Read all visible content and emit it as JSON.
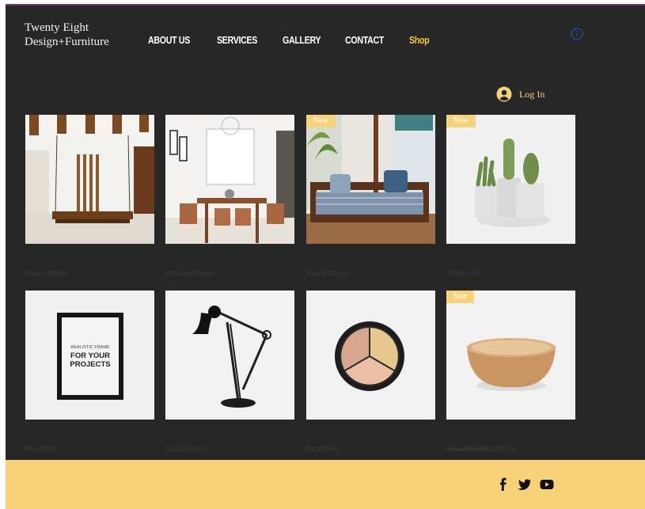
{
  "site": {
    "logo_line1": "Twenty Eight",
    "logo_line2": "Design+Furniture"
  },
  "nav": {
    "about": "ABOUT US",
    "services": "SERVICES",
    "gallery": "GALLERY",
    "contact": "CONTACT",
    "shop": "Shop"
  },
  "login": {
    "label": "Log In"
  },
  "icons": {
    "info": "info-icon",
    "avatar": "user-avatar-icon",
    "facebook": "facebook-icon",
    "twitter": "twitter-icon",
    "youtube": "youtube-icon"
  },
  "colors": {
    "background": "#272727",
    "accent": "#f7d27b",
    "shop_active": "#f5c542",
    "top_line": "#7a2e66"
  },
  "products": [
    {
      "badge": "",
      "price": "Rs.50,000.00",
      "old_price": ""
    },
    {
      "badge": "",
      "price": "Rs.1,00,000.00",
      "old_price": ""
    },
    {
      "badge": "New",
      "price": "Rs.25,000.00",
      "old_price": ""
    },
    {
      "badge": "New",
      "price": "Rs.500.00",
      "old_price": ""
    },
    {
      "badge": "",
      "price": "Rs.500.00",
      "old_price": ""
    },
    {
      "badge": "",
      "price": "Rs.2,000.00",
      "old_price": ""
    },
    {
      "badge": "",
      "price": "Rs.950.00",
      "old_price": ""
    },
    {
      "badge": "Sale",
      "price": "Rs.500.00",
      "old_price": "Rs.1,000.00"
    }
  ]
}
